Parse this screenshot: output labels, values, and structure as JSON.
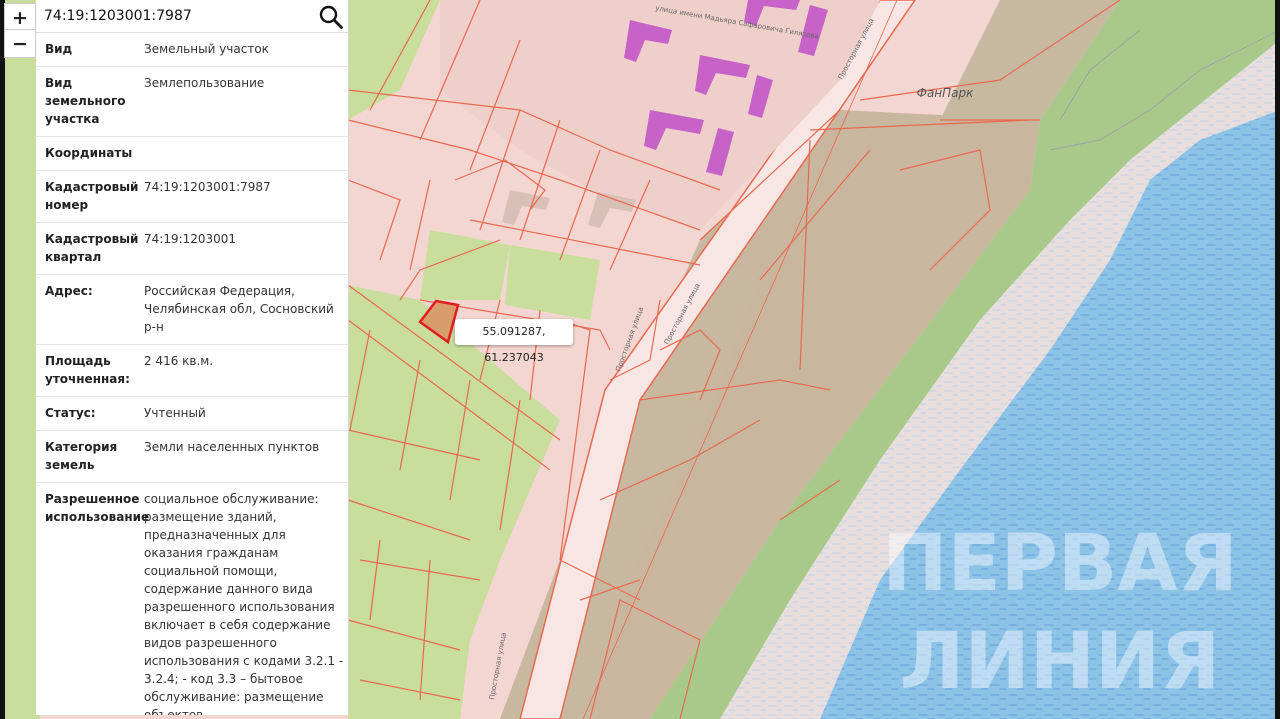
{
  "search": {
    "value": "74:19:1203001:7987"
  },
  "zoom": {
    "in_label": "+",
    "out_label": "−"
  },
  "details": [
    {
      "key": "Вид",
      "value": "Земельный участок"
    },
    {
      "key": "Вид земельного участка",
      "value": "Землепользование"
    },
    {
      "key": "Координаты",
      "value": ""
    },
    {
      "key": "Кадастровый номер",
      "value": "74:19:1203001:7987"
    },
    {
      "key": "Кадастровый квартал",
      "value": "74:19:1203001"
    },
    {
      "key": "Адрес:",
      "value": "Российская Федерация, Челябинская обл, Сосновский р-н"
    },
    {
      "key": "Площадь уточненная:",
      "value": "2 416 кв.м."
    },
    {
      "key": "Статус:",
      "value": "Учтенный"
    },
    {
      "key": "Категория земель",
      "value": "Земли населенных пунктов"
    },
    {
      "key": "Разрешенное использование",
      "value": "социальное обслуживание: размещение зданий, предназначенных для оказания гражданам социальной помощи, содержание данного вида разрешенного использования включает в себя содержание видов разрешенного использования с кодами 3.2.1 - 3.2.4; - код 3.3 – бытовое обслуживание: размещение объектов"
    }
  ],
  "map": {
    "coordinate_label": "55.091287, 61.237043",
    "place_label": "ФанПарк",
    "street_label_1": "Просторная улица",
    "street_label_2": "Просторная улица",
    "street_label_3": "Просторная улица",
    "street_label_4": "улица имени Мадьяра Сафаровича Гилязова",
    "watermark_line1": "ПЕРВАЯ",
    "watermark_line2": "ЛИНИЯ",
    "colors": {
      "parcel_line": "#e8694f",
      "built_area": "#f3d6d1",
      "green": "#c9dd9c",
      "forest": "#a8c98a",
      "water": "#8ec3e8",
      "buildings": "#c762c9",
      "selected_parcel": "#e02020"
    }
  }
}
